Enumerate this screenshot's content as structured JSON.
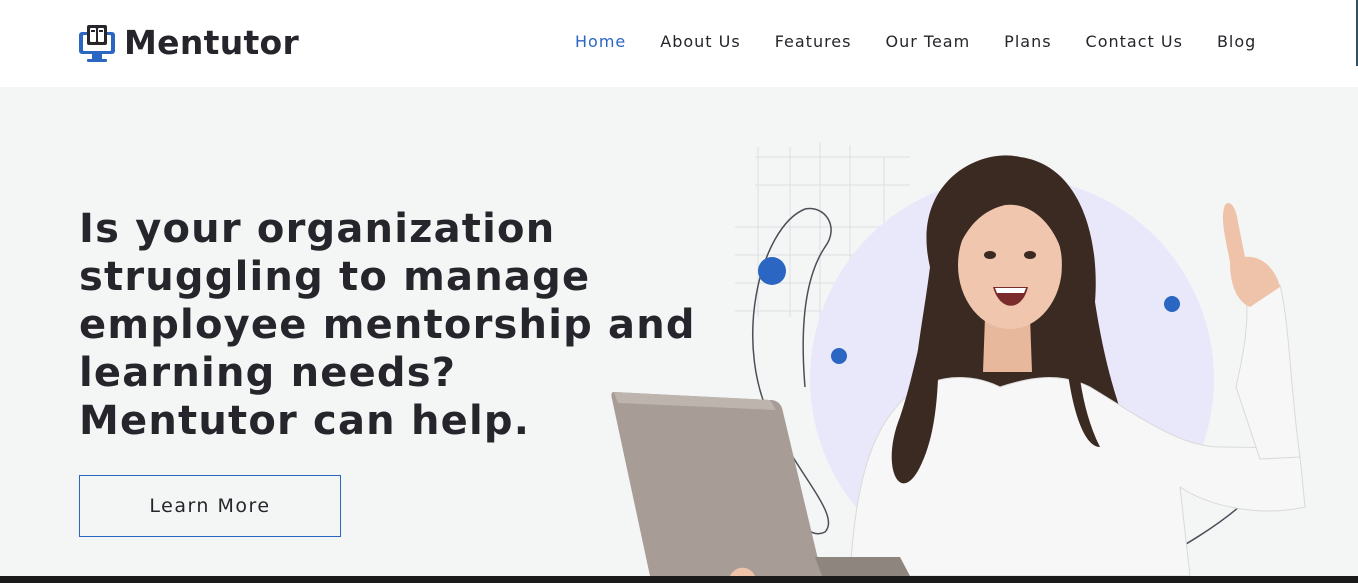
{
  "brand": {
    "name": "Mentutor",
    "accent": "#2b66c2",
    "text_color": "#25252b"
  },
  "nav": {
    "items": [
      {
        "label": "Home",
        "active": true
      },
      {
        "label": "About Us",
        "active": false
      },
      {
        "label": "Features",
        "active": false
      },
      {
        "label": "Our Team",
        "active": false
      },
      {
        "label": "Plans",
        "active": false
      },
      {
        "label": "Contact Us",
        "active": false
      },
      {
        "label": "Blog",
        "active": false
      }
    ]
  },
  "hero": {
    "headline_lines": [
      "Is your organization",
      "struggling to manage",
      "employee mentorship and",
      "learning needs?",
      "Mentutor can help."
    ],
    "cta_label": "Learn More",
    "background": "#f4f6f6"
  },
  "icons": {
    "logo": "monitor-book-icon"
  }
}
